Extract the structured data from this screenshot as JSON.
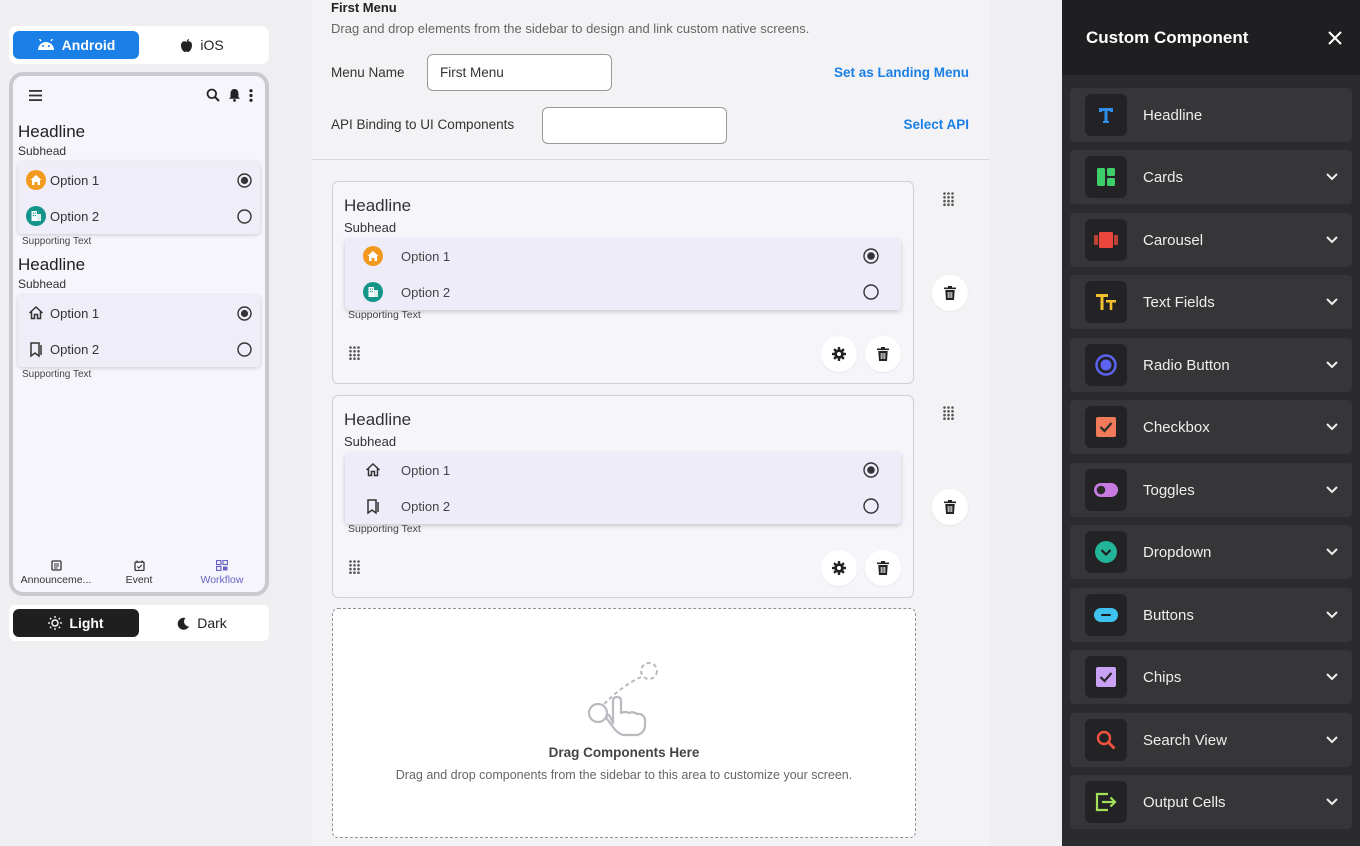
{
  "platform": {
    "android_label": "Android",
    "ios_label": "iOS",
    "selected": "Android"
  },
  "theme": {
    "light_label": "Light",
    "dark_label": "Dark",
    "selected": "Light"
  },
  "preview": {
    "sections": [
      {
        "headline": "Headline",
        "subhead": "Subhead",
        "support": "Supporting Text",
        "options": [
          {
            "label": "Option 1",
            "icon": "home-orange-icon",
            "selected": true
          },
          {
            "label": "Option 2",
            "icon": "building-teal-icon",
            "selected": false
          }
        ]
      },
      {
        "headline": "Headline",
        "subhead": "Subhead",
        "support": "Supporting Text",
        "options": [
          {
            "label": "Option 1",
            "icon": "home-outline-icon",
            "selected": true
          },
          {
            "label": "Option 2",
            "icon": "bookmark-outline-icon",
            "selected": false
          }
        ]
      }
    ],
    "bottom_nav": [
      {
        "label": "Announceme...",
        "icon": "announcement-icon"
      },
      {
        "label": "Event",
        "icon": "calendar-icon"
      },
      {
        "label": "Workflow",
        "icon": "workflow-icon",
        "active": true
      }
    ]
  },
  "editor": {
    "title": "First Menu",
    "description": "Drag and drop elements from the sidebar to design and link custom native screens.",
    "menu_name_label": "Menu Name",
    "menu_name_value": "First Menu",
    "landing_link": "Set as Landing Menu",
    "api_label": "API Binding to UI Components",
    "api_value": "",
    "select_api_link": "Select API",
    "cards": [
      {
        "headline": "Headline",
        "subhead": "Subhead",
        "support": "Supporting Text",
        "options": [
          {
            "label": "Option 1",
            "selected": true
          },
          {
            "label": "Option 2",
            "selected": false
          }
        ]
      },
      {
        "headline": "Headline",
        "subhead": "Subhead",
        "support": "Supporting Text",
        "options": [
          {
            "label": "Option 1",
            "selected": true
          },
          {
            "label": "Option 2",
            "selected": false
          }
        ]
      }
    ],
    "drop_title": "Drag Components Here",
    "drop_desc": "Drag and drop components from the sidebar to this area to customize your screen."
  },
  "panel": {
    "title": "Custom Component",
    "items": [
      {
        "label": "Headline",
        "icon": "headline-icon",
        "color": "#2f8fe8"
      },
      {
        "label": "Cards",
        "icon": "cards-icon",
        "color": "#3ecf6a"
      },
      {
        "label": "Carousel",
        "icon": "carousel-icon",
        "color": "#e8463c"
      },
      {
        "label": "Text Fields",
        "icon": "text-fields-icon",
        "color": "#f2c12e"
      },
      {
        "label": "Radio Button",
        "icon": "radio-button-icon",
        "color": "#5b63f0"
      },
      {
        "label": "Checkbox",
        "icon": "checkbox-icon",
        "color": "#f07a5a"
      },
      {
        "label": "Toggles",
        "icon": "toggle-icon",
        "color": "#c77be0"
      },
      {
        "label": "Dropdown",
        "icon": "dropdown-icon",
        "color": "#22b59a"
      },
      {
        "label": "Buttons",
        "icon": "button-icon",
        "color": "#3fc3ee"
      },
      {
        "label": "Chips",
        "icon": "chips-icon",
        "color": "#c9a2f5"
      },
      {
        "label": "Search View",
        "icon": "search-icon",
        "color": "#f0533e"
      },
      {
        "label": "Output Cells",
        "icon": "output-cells-icon",
        "color": "#a3e05a"
      }
    ]
  }
}
